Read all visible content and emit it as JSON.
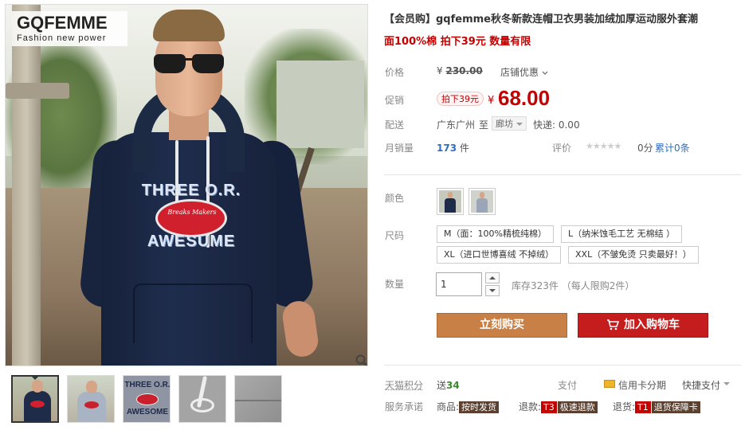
{
  "brand_logo": {
    "main": "GQFEMME",
    "sub": "Fashion new power"
  },
  "hoodie_print": {
    "top": "THREE O.R.",
    "bottom": "AWESUME",
    "ball": "Breaks Makers"
  },
  "thumbs": [
    {
      "name": "thumb-navy-front"
    },
    {
      "name": "thumb-grey-front"
    },
    {
      "name": "thumb-print-closeup",
      "top": "THREE O.R.",
      "bottom": "AWESOME"
    },
    {
      "name": "thumb-drawstring"
    },
    {
      "name": "thumb-fabric"
    }
  ],
  "product": {
    "title": "【会员购】gqfemme秋冬新款连帽卫衣男装加绒加厚运动服外套潮",
    "subtitle": "面100%棉 拍下39元 数量有限"
  },
  "labels": {
    "price": "价格",
    "promo": "促销",
    "shipping": "配送",
    "monthly_sales": "月销量",
    "rating": "评价",
    "color": "颜色",
    "size": "尺码",
    "quantity": "数量",
    "points": "天猫积分",
    "payment": "支付",
    "service": "服务承诺"
  },
  "price": {
    "currency": "¥",
    "original": "230.00",
    "store_discount": "店铺优惠",
    "promo_tag": "拍下39元",
    "current": "68.00"
  },
  "shipping": {
    "from": "广东广州",
    "to_word": "至",
    "destination": "廊坊",
    "express": "快递: 0.00"
  },
  "sales": {
    "count": "173",
    "unit": "件"
  },
  "rating": {
    "stars": "★★★★★",
    "score": "0分",
    "reviews": "累计0条"
  },
  "sizes": [
    "M（面：100%精梳纯棉）",
    "L（纳米蚀毛工艺 无棉结 ）",
    "XL（进口世博喜绒 不掉绒）",
    "XXL（不皱免烫 只卖最好！）"
  ],
  "quantity": {
    "value": "1",
    "stock": "库存323件 （每人限购2件）"
  },
  "buttons": {
    "buy_now": "立刻购买",
    "add_to_cart": "加入购物车"
  },
  "points": {
    "prefix": "送",
    "value": "34"
  },
  "payment": {
    "card": "信用卡分期",
    "quick": "快捷支付"
  },
  "service": {
    "goods_label": "商品:",
    "goods_badge": "按时发货",
    "refund_label": "退款:",
    "refund_code": "T3",
    "refund_badge": "极速退款",
    "return_label": "退货:",
    "return_code": "T1",
    "return_badge": "退货保障卡"
  },
  "colors": {
    "price_red": "#c40000",
    "buy_orange": "#c88046",
    "cart_red": "#c51d1d",
    "link_blue": "#2f6ebe"
  }
}
